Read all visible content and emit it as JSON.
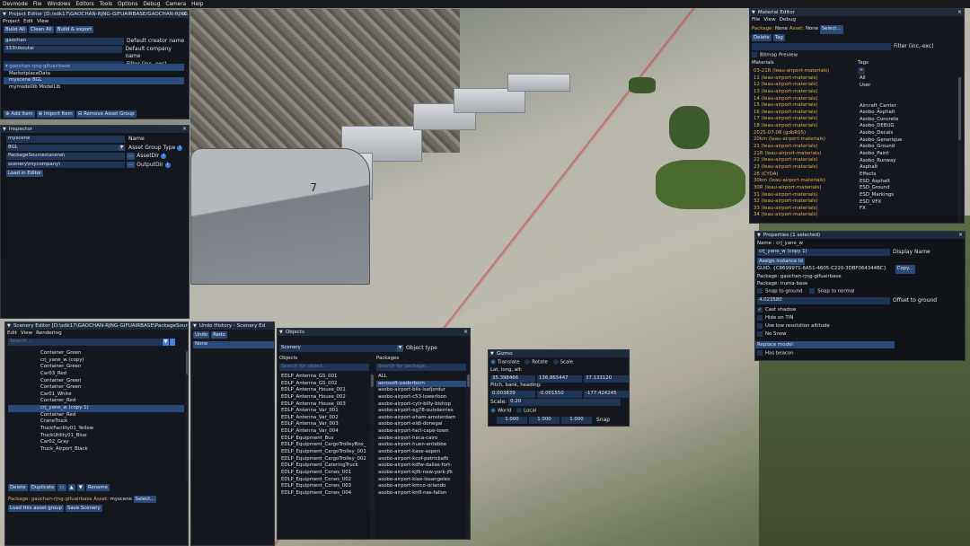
{
  "menubar": [
    "Devmode",
    "File",
    "Windows",
    "Editors",
    "Tools",
    "Options",
    "Debug",
    "Camera",
    "Help"
  ],
  "project": {
    "title": "Project Editor [D:/sdk17\\GAOCHAN-RJNG-GIFUAIRBASE/GAOCHAN-RJNG",
    "menu": [
      "Project",
      "Edit",
      "View"
    ],
    "buttons": [
      "Build All",
      "Clean All",
      "Build & export"
    ],
    "rows": [
      {
        "value": "gaochan",
        "label": "Default creator name"
      },
      {
        "value": "333hikoutai",
        "label": "Default company name"
      },
      {
        "value": "",
        "label": "Filter (inc,-exc)"
      }
    ],
    "tree": [
      "gaochan-rjng-gifuairbase",
      "MarketplaceData",
      "myscene BGL",
      "mymodellib ModelLib"
    ],
    "footer": [
      "Add Item",
      "Import Item",
      "Remove Asset Group"
    ]
  },
  "inspector": {
    "title": "Inspector",
    "rows": [
      {
        "value": "myscene",
        "label": "Name"
      },
      {
        "value": "BGL",
        "label": "Asset Group Type"
      },
      {
        "value": "PackageSources\\scene\\",
        "label": "AssetDir"
      },
      {
        "value": "scenery\\mycompany\\",
        "label": "OutputDir"
      }
    ],
    "load": "Load in Editor"
  },
  "scenery": {
    "title": "Scenery Editor [D:\\sdk17\\GAOCHAN-RJNG-GIFUAIRBASE\\PackageSour",
    "menu": [
      "Edit",
      "View",
      "Rendering"
    ],
    "search": "Search ...",
    "items": [
      "Container_Green",
      "crj_yane_w (copy)",
      "Container_Green",
      "Car03_Red",
      "Container_Green",
      "Container_Green",
      "Car01_White",
      "Container_Red",
      "crj_yane_w (copy 1)",
      "Container_Red",
      "CraneTruck",
      "TruckFacility01_Yellow",
      "TruckUtility01_Blue",
      "Car02_Gray",
      "Truck_Airport_Black"
    ],
    "buttons": [
      "Delete",
      "Duplicate",
      "Rename"
    ],
    "package_label": "Package:",
    "package": "gaochan-rjng-gifuairbase",
    "asset_label": "Asset:",
    "asset": "myscene",
    "select": "Select...",
    "load_group": "Load this asset group",
    "save": "Save Scenery"
  },
  "undo": {
    "title": "Undo History - Scenery Ed",
    "buttons": [
      "Undo",
      "Redo"
    ],
    "items": [
      "None"
    ]
  },
  "objects": {
    "title": "Objects",
    "type": "Scenery",
    "type_label": "Object type",
    "col_objects": "Objects",
    "col_packages": "Packages",
    "search_obj": "Search for object...",
    "search_pkg": "Search for package...",
    "objects_list": [
      "EDLP_Antenna_GS_001",
      "EDLP_Antenna_GS_002",
      "EDLP_Antenna_House_001",
      "EDLP_Antenna_House_002",
      "EDLP_Antenna_House_003",
      "EDLP_Antenna_Var_001",
      "EDLP_Antenna_Var_002",
      "EDLP_Antenna_Var_003",
      "EDLP_Antenna_Var_004",
      "EDLP_Equipment_Bus",
      "EDLP_Equipment_CargoTrolleyBox_",
      "EDLP_Equipment_CargoTrolley_001",
      "EDLP_Equipment_CargoTrolley_002",
      "EDLP_Equipment_CateringTruck",
      "EDLP_Equipment_Cones_001",
      "EDLP_Equipment_Cones_002",
      "EDLP_Equipment_Cones_003",
      "EDLP_Equipment_Cones_004"
    ],
    "packages_list": [
      "ALL",
      "aerosoft-paderborn",
      "asobo-airport-biis-isafjordur",
      "asobo-airport-c53-lowerloon",
      "asobo-airport-cytr-billy-bishop",
      "asobo-airport-eg78-outskerries",
      "asobo-airport-eham-amsterdam",
      "asobo-airport-eidl-donegal",
      "asobo-airport-fact-cape-town",
      "asobo-airport-heca-cairo",
      "asobo-airport-huen-entebbe",
      "asobo-airport-kase-aspen",
      "asobo-airport-kcof-patrickafb",
      "asobo-airport-kdfw-dallas-fort-",
      "asobo-airport-kjfk-new-york-jfk",
      "asobo-airport-klax-losangeles",
      "asobo-airport-kmco-orlando",
      "asobo-airport-knfl-nas-fallon"
    ]
  },
  "gizmo": {
    "title": "Gizmo",
    "modes": [
      "Translate",
      "Rotate",
      "Scale"
    ],
    "lla_label": "Lat, long, alt:",
    "lla": [
      "35.398466",
      "136.865447",
      "37.133120"
    ],
    "pbh_label": "Pitch, bank, heading:",
    "pbh": [
      "0.003839",
      "-0.001550",
      "-177.424245"
    ],
    "scale_label": "Scale:",
    "scale": "0.20",
    "space": [
      "World",
      "Local"
    ],
    "snap": [
      "1.000",
      "1.000",
      "1.000"
    ],
    "snap_label": "Snap"
  },
  "material": {
    "title": "Material Editor",
    "menu": [
      "File",
      "View",
      "Debug"
    ],
    "pkg_label": "Package:",
    "pkg": "None",
    "asset_label": "Asset:",
    "asset": "None",
    "select": "Select...",
    "buttons": [
      "Delete",
      "Tag"
    ],
    "filter_label": "Filter (inc,-exc)",
    "bitmap": "Bitmap Preview",
    "col_mat": "Materials",
    "col_tags": "Tags",
    "materials": [
      "03-21R (leau-airport-materials)",
      "11 (leau-airport-materials)",
      "12 (leau-airport-materials)",
      "13 (leau-airport-materials)",
      "14 (leau-airport-materials)",
      "15 (leau-airport-materials)",
      "16 (leau-airport-materials)",
      "17 (leau-airport-materials)",
      "18 (leau-airport-materials)",
      "2025-07-08 (gdbRS5)",
      "20km (leau-airport-materials)",
      "21 (leau-airport-materials)",
      "21R (leau-airport-materials)",
      "22 (leau-airport-materials)",
      "23 (leau-airport-materials)",
      "28 (CYDA)",
      "30km (leau-airport-materials)",
      "30R (leau-airport-materials)",
      "31 (leau-airport-materials)",
      "32 (leau-airport-materials)",
      "33 (leau-airport-materials)",
      "34 (leau-airport-materials)"
    ],
    "tags": [
      "All",
      "User",
      "",
      "",
      "Aircraft_Carrier",
      "Asobo_Asphalt",
      "Asobo_Concrete",
      "Asobo_DEBUG",
      "Asobo_Decals",
      "Asobo_Generique",
      "Asobo_Ground",
      "Asobo_Paint",
      "Asobo_Runway",
      "Asphalt",
      "Effects",
      "ESD_Asphalt",
      "ESD_Ground",
      "ESD_Markings",
      "ESD_VFX",
      "FX"
    ]
  },
  "properties": {
    "title": "Properties (1 selected)",
    "name_label": "Name :",
    "name": "crj_yane_w",
    "display_value": "crj_yane_w (copy 1)",
    "display_label": "Display Name",
    "assign": "Assign instance Id",
    "guid_label": "GUID:",
    "guid": "{C8699971-8A51-4605-C220-3DBF064344BC}",
    "copy": "Copy...",
    "pkg1": "Package: gaochan-rjng-gifuairbase",
    "pkg2": "Package: iruma-base",
    "snap_ground": "Snap to ground",
    "snap_normal": "Snap to normal",
    "offset": "4.023580",
    "offset_label": "Offset to ground",
    "checks": [
      {
        "label": "Cast shadow",
        "on": true
      },
      {
        "label": "Hide on TIN",
        "on": false
      },
      {
        "label": "Use low resolution altitude",
        "on": false
      },
      {
        "label": "No Snow",
        "on": false
      }
    ],
    "replace": "Replace model",
    "beacon": "Has beacon"
  }
}
